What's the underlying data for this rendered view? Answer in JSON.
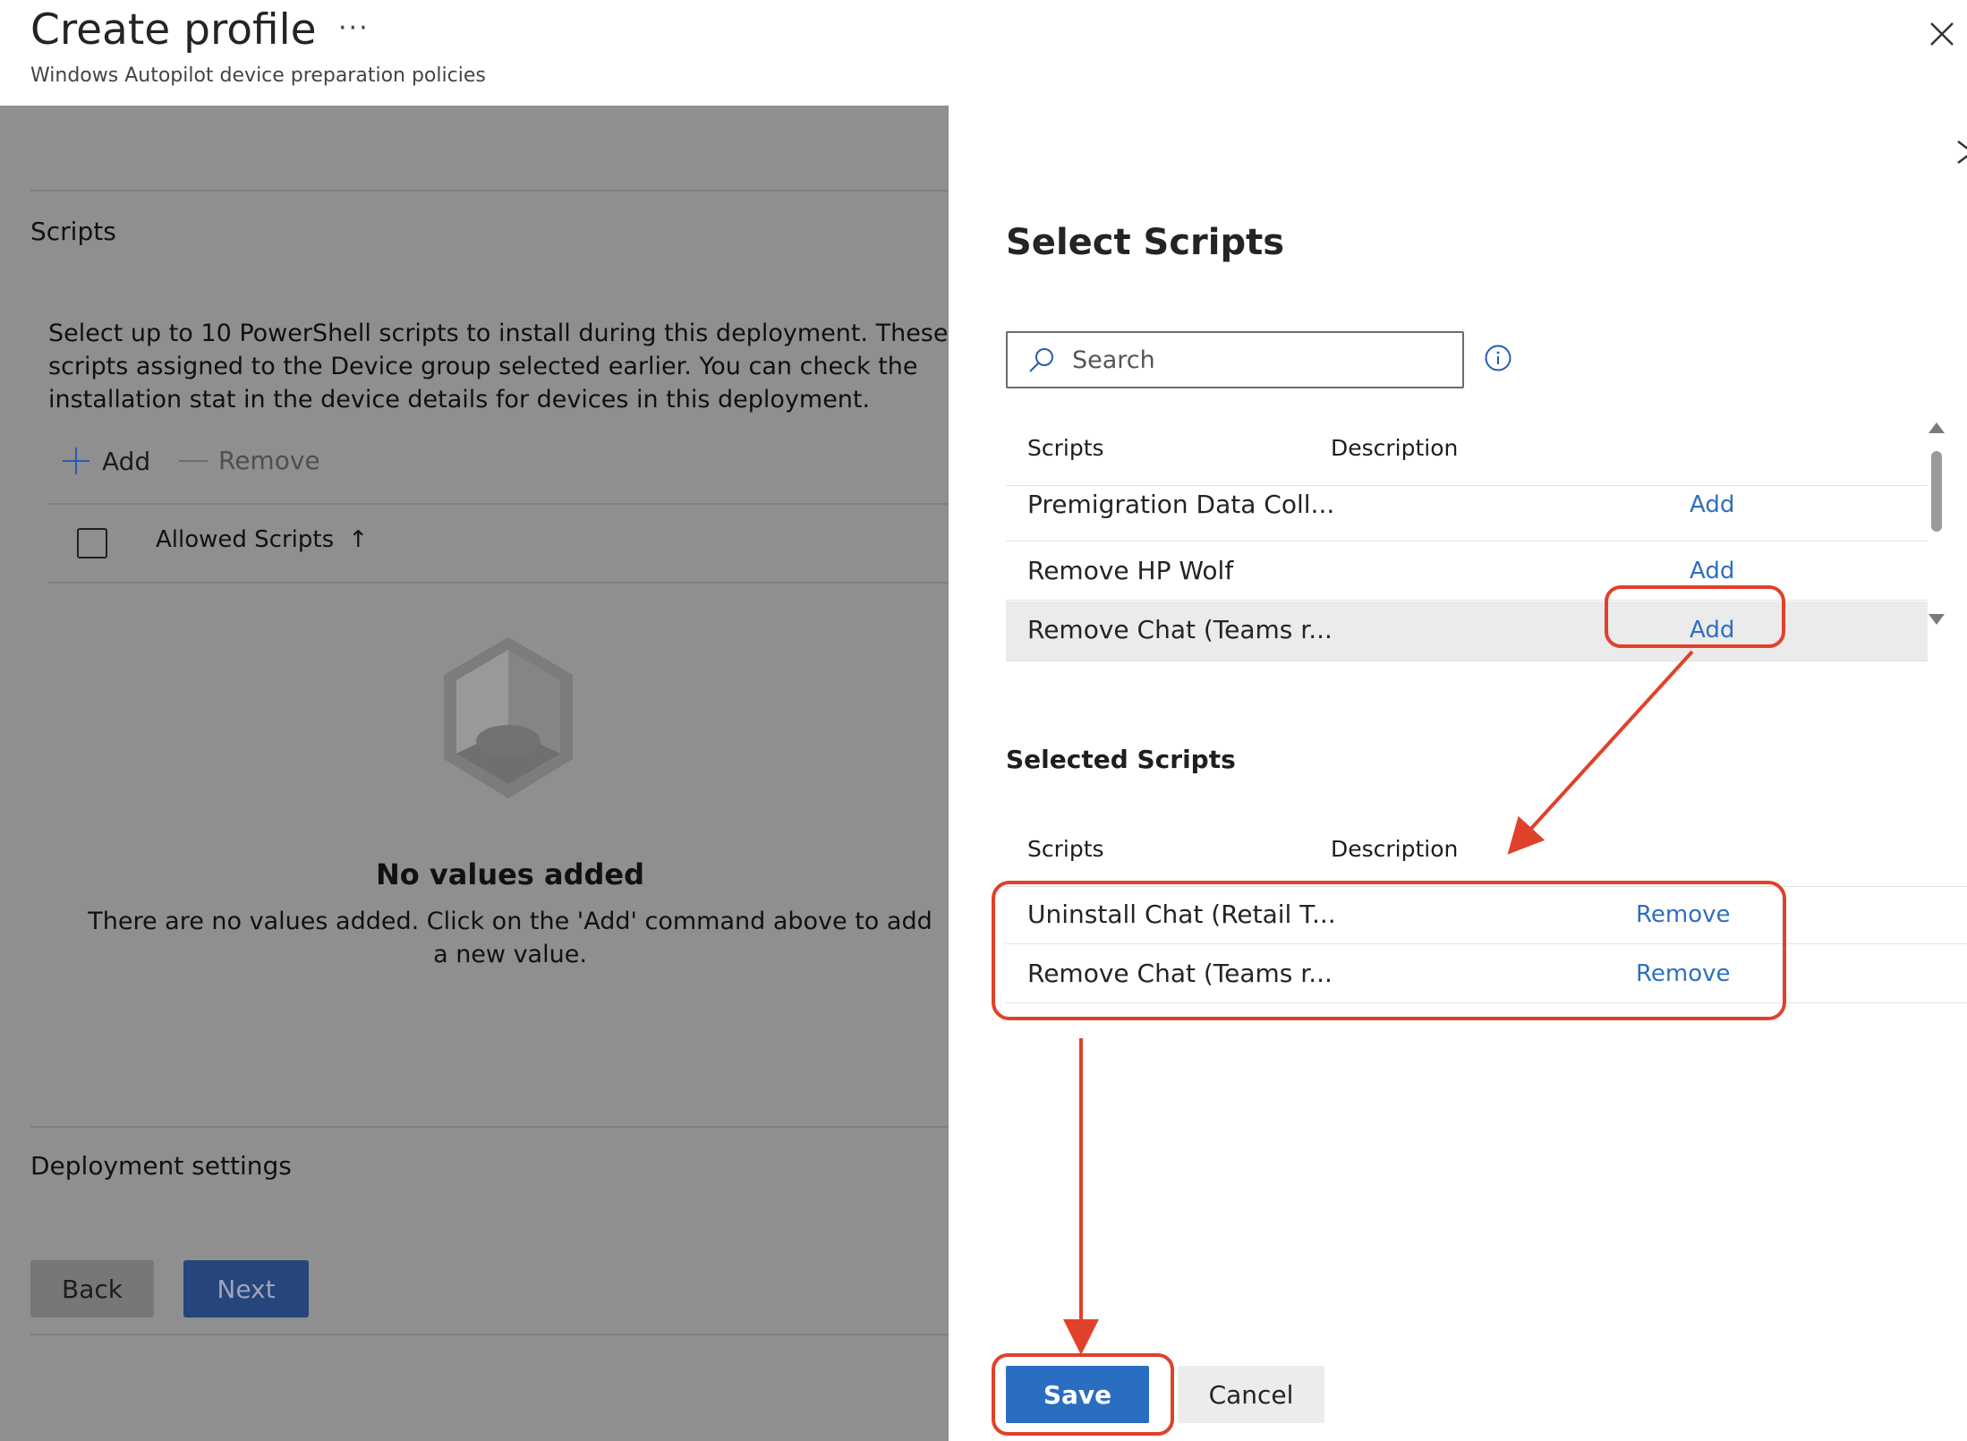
{
  "header": {
    "title": "Create profile",
    "more": "···",
    "subtitle": "Windows Autopilot device preparation policies"
  },
  "left": {
    "scripts_section_title": "Scripts",
    "description": "Select up to 10 PowerShell scripts to install during this deployment. These scripts assigned to the Device group selected earlier. You can check the installation stat in the device details for devices in this deployment.",
    "add_label": "Add",
    "remove_label": "Remove",
    "column_allowed_scripts": "Allowed Scripts",
    "sort_arrow": "↑",
    "empty_title": "No values added",
    "empty_text": "There are no values added. Click on the 'Add' command above to add a new value.",
    "deployment_settings_title": "Deployment settings",
    "back_label": "Back",
    "next_label": "Next"
  },
  "panel": {
    "title": "Select Scripts",
    "search_placeholder": "Search",
    "table_headers": {
      "scripts": "Scripts",
      "description": "Description"
    },
    "available": [
      {
        "name": "Premigration Data Coll...",
        "action": "Add"
      },
      {
        "name": "Remove HP Wolf",
        "action": "Add"
      },
      {
        "name": "Remove Chat (Teams r...",
        "action": "Add"
      }
    ],
    "selected_title": "Selected Scripts",
    "selected_headers": {
      "scripts": "Scripts",
      "description": "Description"
    },
    "selected": [
      {
        "name": "Uninstall Chat (Retail T...",
        "action": "Remove"
      },
      {
        "name": "Remove Chat (Teams r...",
        "action": "Remove"
      }
    ],
    "save_label": "Save",
    "cancel_label": "Cancel"
  },
  "colors": {
    "accent": "#2a6ec2",
    "link": "#2f6fbf",
    "annotation": "#e0412a",
    "overlay": "#8f8f8f"
  }
}
